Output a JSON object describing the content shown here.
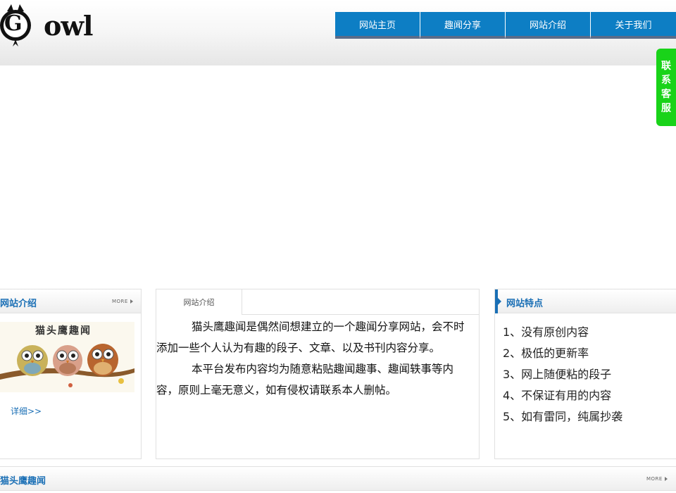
{
  "header": {
    "logo_text": "owl",
    "logo_letter": "G"
  },
  "nav": {
    "items": [
      "网站主页",
      "趣闻分享",
      "网站介绍",
      "关于我们"
    ]
  },
  "contact": {
    "chars": [
      "联",
      "系",
      "客",
      "服"
    ]
  },
  "left_panel": {
    "title": "网站介绍",
    "more": "MORE",
    "image_caption": "猫头鹰趣闻",
    "detail_link": "详细>>"
  },
  "center_panel": {
    "tab": "网站介绍",
    "paragraphs": [
      "猫头鹰趣闻是偶然间想建立的一个趣闻分享网站，会不时添加一些个人认为有趣的段子、文章、以及书刊内容分享。",
      "本平台发布内容均为随意粘贴趣闻趣事、趣闻轶事等内容，原则上毫无意义，如有侵权请联系本人删帖。"
    ]
  },
  "right_panel": {
    "title": "网站特点",
    "features": [
      "1、没有原创内容",
      "2、极低的更新率",
      "3、网上随便粘的段子",
      "4、不保证有用的内容",
      "5、如有雷同，纯属抄袭"
    ]
  },
  "bottom_panel": {
    "title": "猫头鹰趣闻",
    "more": "MORE"
  },
  "colors": {
    "nav_blue": "#0d7ec4",
    "title_blue": "#1a6fb5",
    "contact_green": "#19d319"
  }
}
